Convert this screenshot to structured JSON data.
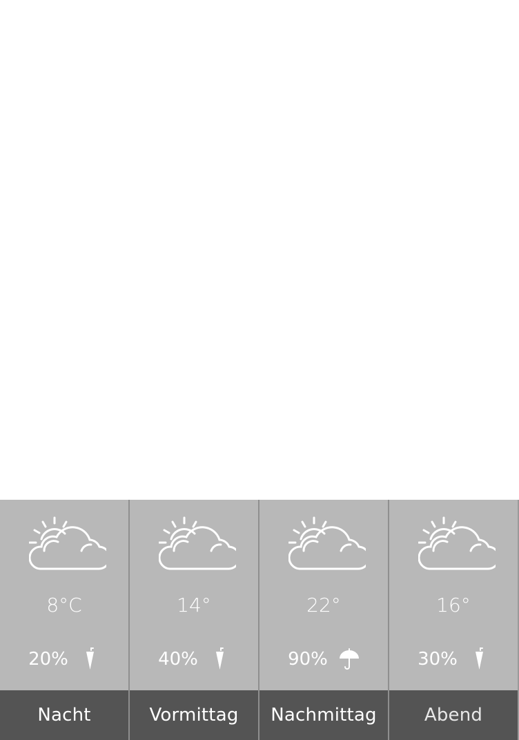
{
  "forecast": {
    "periods": [
      {
        "label": "Nacht",
        "temperature": "8°C",
        "precipitation": "20%",
        "weather_icon": "partly-cloudy-icon",
        "precip_icon": "closed-umbrella-icon"
      },
      {
        "label": "Vormittag",
        "temperature": "14°",
        "precipitation": "40%",
        "weather_icon": "partly-cloudy-icon",
        "precip_icon": "closed-umbrella-icon"
      },
      {
        "label": "Nachmittag",
        "temperature": "22°",
        "precipitation": "90%",
        "weather_icon": "partly-cloudy-icon",
        "precip_icon": "open-umbrella-icon"
      },
      {
        "label": "Abend",
        "temperature": "16°",
        "precipitation": "30%",
        "weather_icon": "partly-cloudy-icon",
        "precip_icon": "closed-umbrella-icon"
      }
    ]
  },
  "colors": {
    "upper_background": "#b8b8b8",
    "label_background": "#545454",
    "text": "#ffffff",
    "divider": "#8f8f8f"
  }
}
